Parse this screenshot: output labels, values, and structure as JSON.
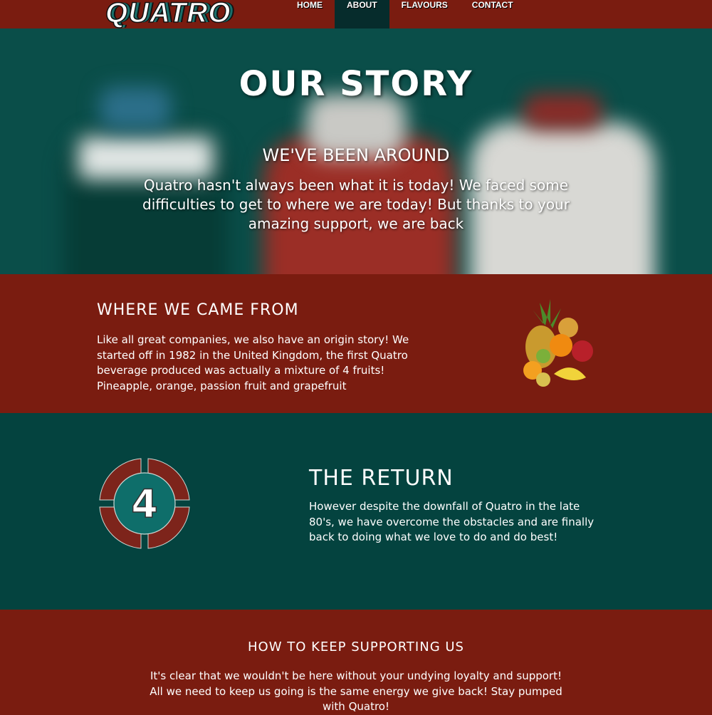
{
  "nav": {
    "logo": "QUATRO",
    "items": [
      {
        "label": "HOME"
      },
      {
        "label": "ABOUT"
      },
      {
        "label": "FLAVOURS"
      },
      {
        "label": "CONTACT"
      }
    ],
    "active": "ABOUT"
  },
  "hero": {
    "title": "OUR STORY",
    "subtitle": "WE'VE BEEN AROUND",
    "text": "Quatro hasn't always been what it is today! We faced some difficulties to get to where we are today! But thanks to your amazing support, we are back"
  },
  "origin": {
    "title": "WHERE WE CAME FROM",
    "text": "Like all great companies, we also have an origin story! We started off in 1982 in the United Kingdom, the first Quatro beverage produced was actually a mixture of 4 fruits! Pineapple, orange, passion fruit and grapefruit"
  },
  "return": {
    "badge": "4",
    "title": "THE RETURN",
    "text": "However despite the downfall of Quatro in the late 80's, we have overcome the obstacles and are finally back to doing what we love to do and do best!"
  },
  "support": {
    "title": "HOW TO KEEP SUPPORTING US",
    "text": "It's clear that we wouldn't be here without your undying loyalty and support! All we need to keep us going is the same energy we give back! Stay pumped with Quatro!"
  },
  "colors": {
    "red": "#7a1c10",
    "teal": "#04433f",
    "nav_active": "#062c2c"
  }
}
